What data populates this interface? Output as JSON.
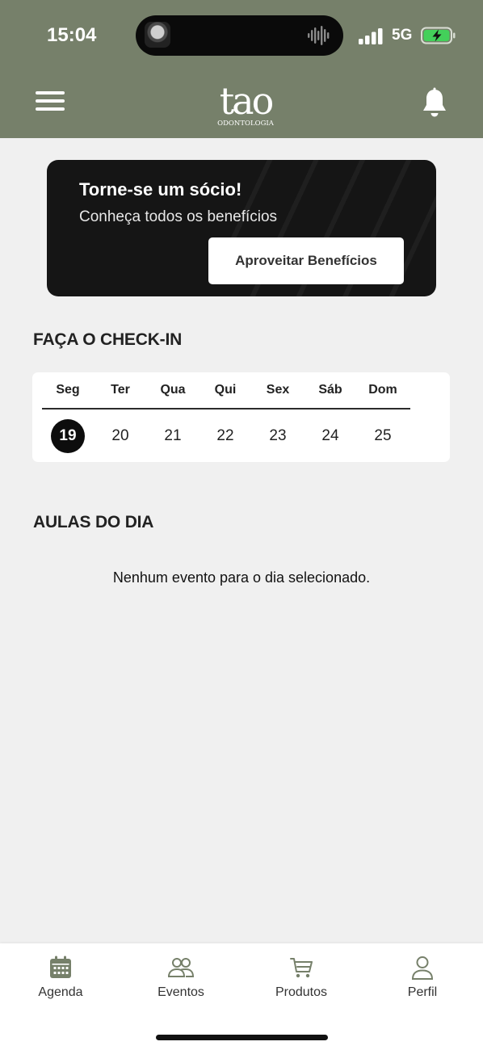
{
  "status_bar": {
    "time": "15:04",
    "network": "5G",
    "battery_charging": true
  },
  "header": {
    "logo_main": "tao",
    "logo_sub": "ODONTOLOGIA",
    "menu_icon": "hamburger-menu-icon",
    "notification_icon": "bell-icon",
    "background_color": "#76806a"
  },
  "promo": {
    "title": "Torne-se um sócio!",
    "subtitle": "Conheça todos os benefícios",
    "button_label": "Aproveitar Benefícios"
  },
  "checkin": {
    "title": "FAÇA O CHECK-IN",
    "days": [
      {
        "label": "Seg",
        "date": "19",
        "selected": true
      },
      {
        "label": "Ter",
        "date": "20",
        "selected": false
      },
      {
        "label": "Qua",
        "date": "21",
        "selected": false
      },
      {
        "label": "Qui",
        "date": "22",
        "selected": false
      },
      {
        "label": "Sex",
        "date": "23",
        "selected": false
      },
      {
        "label": "Sáb",
        "date": "24",
        "selected": false
      },
      {
        "label": "Dom",
        "date": "25",
        "selected": false
      }
    ]
  },
  "classes": {
    "title": "AULAS DO DIA",
    "empty_message": "Nenhum evento para o dia selecionado."
  },
  "tabbar": {
    "tabs": [
      {
        "label": "Agenda",
        "icon": "calendar-icon"
      },
      {
        "label": "Eventos",
        "icon": "people-icon"
      },
      {
        "label": "Produtos",
        "icon": "cart-icon"
      },
      {
        "label": "Perfil",
        "icon": "user-icon"
      }
    ]
  }
}
